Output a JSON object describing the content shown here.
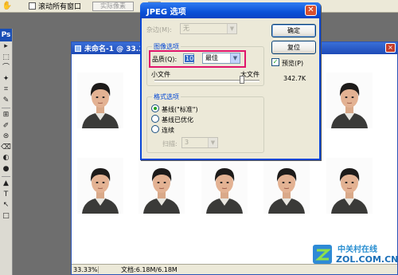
{
  "options_bar": {
    "tool_icon": "hand-tool-icon",
    "checkbox_label": "滚动所有窗口",
    "button_label": "实际像素"
  },
  "toolbox": {
    "logo": "Ps",
    "tools": [
      "▸",
      "⬚",
      "⌒",
      "✦",
      "⌗",
      "✎",
      "⊞",
      "✐",
      "⊜",
      "⌫",
      "◐",
      "●",
      "▲",
      "T",
      "↖",
      "□"
    ]
  },
  "document": {
    "title": "未命名-1 @ 33.3",
    "zoom": "33.33%",
    "doc_size": "文档:6.18M/6.18M"
  },
  "watermark": {
    "name": "中关村在线",
    "domain": "ZOL.COM.CN"
  },
  "dialog": {
    "title": "JPEG 选项",
    "matte_label": "杂边(M):",
    "matte_value": "无",
    "image_options_title": "图像选项",
    "quality_label": "品质(Q):",
    "quality_value": "10",
    "quality_preset": "最佳",
    "small_file_label": "小文件",
    "large_file_label": "大文件",
    "quality_fraction": 0.83,
    "format_options_title": "格式选项",
    "formats": [
      "基线(\"标准\")",
      "基线已优化",
      "连续"
    ],
    "format_selected": 0,
    "scans_label": "扫描:",
    "scans_value": "3",
    "ok_label": "确定",
    "reset_label": "复位",
    "preview_label": "预览(P)",
    "preview_checked": true,
    "file_size": "342.7K"
  }
}
